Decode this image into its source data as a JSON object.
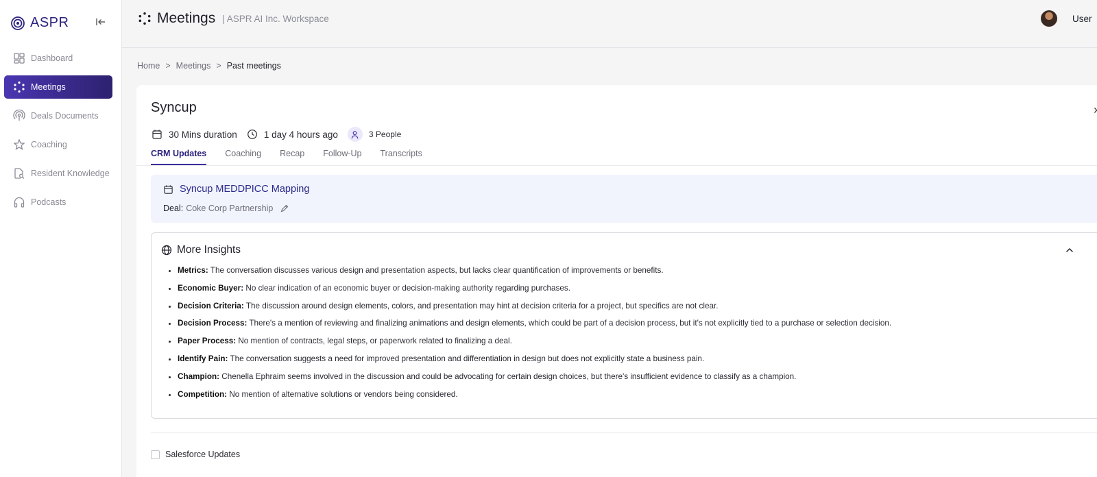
{
  "app": {
    "brand": "ASPR"
  },
  "sidebar": {
    "items": [
      {
        "label": "Dashboard",
        "icon": "dashboard-icon"
      },
      {
        "label": "Meetings",
        "icon": "meetings-icon",
        "active": true
      },
      {
        "label": "Deals Documents",
        "icon": "podcast-signal-icon"
      },
      {
        "label": "Coaching",
        "icon": "star-people-icon"
      },
      {
        "label": "Resident Knowledge",
        "icon": "document-search-icon"
      },
      {
        "label": "Podcasts",
        "icon": "headphones-icon"
      }
    ]
  },
  "header": {
    "title": "Meetings",
    "subtitle": "| ASPR AI Inc. Workspace",
    "user_label": "User"
  },
  "breadcrumb": {
    "home": "Home",
    "sep": ">",
    "meetings": "Meetings",
    "current": "Past meetings"
  },
  "meeting": {
    "title": "Syncup",
    "duration": "30 Mins duration",
    "when": "1 day 4 hours ago",
    "people": "3 People"
  },
  "tabs": [
    {
      "label": "CRM Updates",
      "active": true
    },
    {
      "label": "Coaching"
    },
    {
      "label": "Recap"
    },
    {
      "label": "Follow-Up"
    },
    {
      "label": "Transcripts"
    }
  ],
  "deal_box": {
    "title": "Syncup MEDDPICC Mapping",
    "deal_label": "Deal:",
    "deal_value": "Coke Corp Partnership"
  },
  "insights": {
    "heading": "More Insights",
    "items": [
      {
        "label": "Metrics:",
        "text": "The conversation discusses various design and presentation aspects, but lacks clear quantification of improvements or benefits."
      },
      {
        "label": "Economic Buyer:",
        "text": "No clear indication of an economic buyer or decision-making authority regarding purchases."
      },
      {
        "label": "Decision Criteria:",
        "text": "The discussion around design elements, colors, and presentation may hint at decision criteria for a project, but specifics are not clear."
      },
      {
        "label": "Decision Process:",
        "text": "There's a mention of reviewing and finalizing animations and design elements, which could be part of a decision process, but it's not explicitly tied to a purchase or selection decision."
      },
      {
        "label": "Paper Process:",
        "text": "No mention of contracts, legal steps, or paperwork related to finalizing a deal."
      },
      {
        "label": "Identify Pain:",
        "text": "The conversation suggests a need for improved presentation and differentiation in design but does not explicitly state a business pain."
      },
      {
        "label": "Champion:",
        "text": "Chenella Ephraim seems involved in the discussion and could be advocating for certain design choices, but there's insufficient evidence to classify as a champion."
      },
      {
        "label": "Competition:",
        "text": "No mention of alternative solutions or vendors being considered."
      }
    ]
  },
  "salesforce": {
    "label": "Salesforce Updates",
    "checked": false
  },
  "colors": {
    "accent": "#2b237f",
    "active_nav_start": "#4a36b0",
    "active_nav_end": "#2d2170",
    "deal_box_bg": "#f1f3fd"
  }
}
